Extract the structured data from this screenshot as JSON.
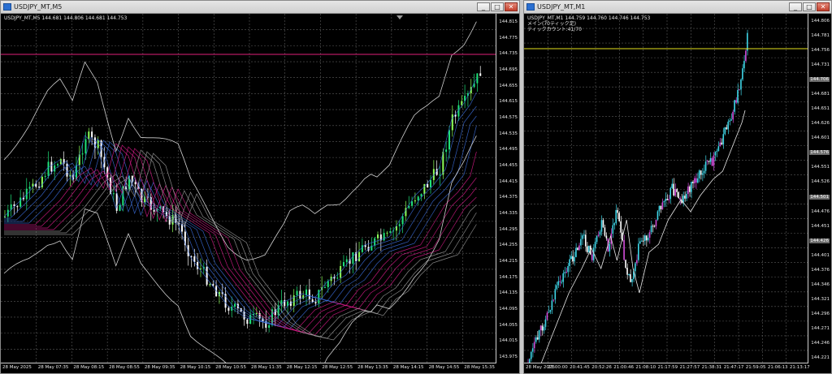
{
  "left_window": {
    "title": "USDJPY_MT,M5",
    "info_line": "USDJPY_MT,M5  144.681 144.806 144.681 144.753",
    "price_labels": [
      "144.815",
      "144.775",
      "144.735",
      "144.695",
      "144.655",
      "144.615",
      "144.575",
      "144.535",
      "144.495",
      "144.455",
      "144.415",
      "144.375",
      "144.335",
      "144.295",
      "144.255",
      "144.215",
      "144.175",
      "144.135",
      "144.095",
      "144.055",
      "144.015",
      "143.975"
    ],
    "current_price": "144.753",
    "time_labels": [
      "28 May 2025",
      "28 May 07:35",
      "28 May 08:15",
      "28 May 08:55",
      "28 May 09:35",
      "28 May 10:15",
      "28 May 10:55",
      "28 May 11:35",
      "28 May 12:15",
      "28 May 12:55",
      "28 May 13:35",
      "28 May 14:15",
      "28 May 14:55",
      "28 May 15:35"
    ]
  },
  "right_window": {
    "title": "USDJPY_MT,M1",
    "info_line": "USDJPY_MT,M1  144.759 144.760 144.746 144.753",
    "info_line2": "メイン(70ティック足)",
    "info_line3": "ティックカウント:41/70",
    "price_labels": [
      "144.806",
      "144.781",
      "144.756",
      "144.731",
      "144.706",
      "144.681",
      "144.651",
      "144.626",
      "144.601",
      "144.576",
      "144.551",
      "144.526",
      "144.501",
      "144.476",
      "144.451",
      "144.426",
      "144.401",
      "144.376",
      "144.346",
      "144.321",
      "144.296",
      "144.271",
      "144.246",
      "144.221"
    ],
    "highlight_prices": {
      "144.753": "yel",
      "144.706": "grey",
      "144.576": "grey",
      "144.501": "grey",
      "144.426": "grey"
    },
    "time_labels": [
      "28 May 2025",
      "21:00:00",
      "20:41:45",
      "20:52:26",
      "21:00:46",
      "21:08:10",
      "21:17:59",
      "21:27:57",
      "21:38:31",
      "21:47:17",
      "21:59:05",
      "21:06:13",
      "21:13:17"
    ]
  },
  "window_buttons": {
    "minimize": "_",
    "maximize": "□",
    "close": "✕"
  },
  "colors": {
    "bull": "#1fe37a",
    "bull2": "#8cff58",
    "bear": "#ffffff",
    "ma_pink": "#d81b8a",
    "ma_blue": "#3a6bd8",
    "line_magenta": "#e0207a",
    "line_yellow": "#e6e21e",
    "bb": "#d0d0d0"
  }
}
